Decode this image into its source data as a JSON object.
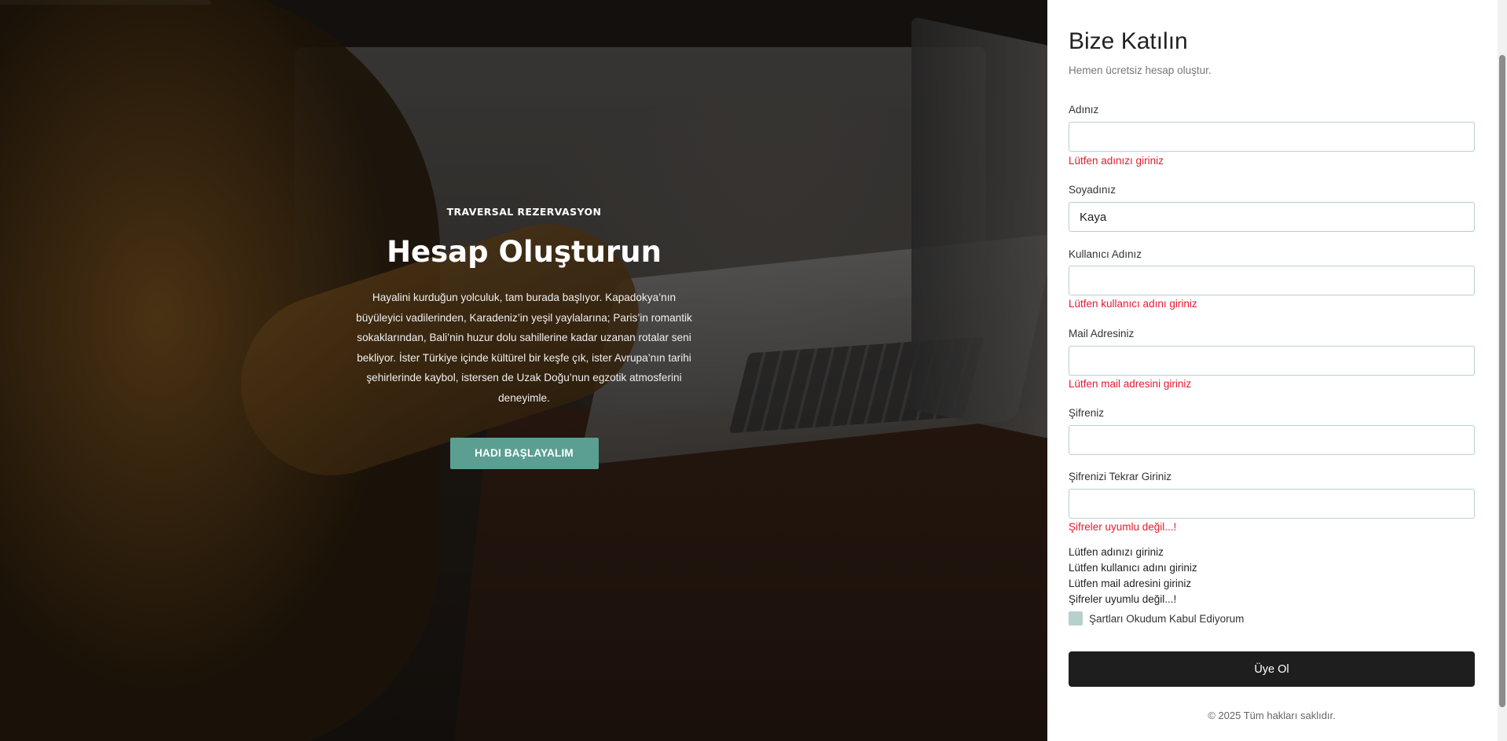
{
  "hero": {
    "eyebrow": "TRAVERSAL REZERVASYON",
    "title": "Hesap Oluşturun",
    "lines": [
      "Hayalini kurduğun yolculuk, tam burada başlıyor. Kapadokya’nın",
      "büyüleyici vadilerinden, Karadeniz’in yeşil yaylalarına; Paris’in romantik",
      "sokaklarından, Bali’nin huzur dolu sahillerine kadar uzanan rotalar seni",
      "bekliyor. İster Türkiye içinde kültürel bir keşfe çık, ister Avrupa’nın tarihi",
      "şehirlerinde kaybol, istersen de Uzak Doğu’nun egzotik atmosferini",
      "deneyimle."
    ],
    "button": "HADI BAŞLAYALIM",
    "accent_color": "#5a9f92"
  },
  "form": {
    "title": "Bize Katılın",
    "subtitle": "Hemen ücretsiz hesap oluştur.",
    "fields": {
      "first_name": {
        "label": "Adınız",
        "value": "",
        "error": "Lütfen adınızı giriniz"
      },
      "last_name": {
        "label": "Soyadınız",
        "value": "Kaya"
      },
      "username": {
        "label": "Kullanıcı Adınız",
        "value": "",
        "error": "Lütfen kullanıcı adını giriniz"
      },
      "email": {
        "label": "Mail Adresiniz",
        "value": "",
        "error": "Lütfen mail adresini giriniz"
      },
      "password": {
        "label": "Şifreniz",
        "value": ""
      },
      "password_confirm": {
        "label": "Şifrenizi Tekrar Giriniz",
        "value": "",
        "error": "Şifreler uyumlu değil...!"
      }
    },
    "summary_errors": [
      "Lütfen adınızı giriniz",
      "Lütfen kullanıcı adını giriniz",
      "Lütfen mail adresini giriniz",
      "Şifreler uyumlu değil...!"
    ],
    "terms_label": "Şartları Okudum Kabul Ediyorum",
    "terms_checked": false,
    "submit": "Üye Ol",
    "footer": "© 2025 Tüm hakları saklıdır.",
    "error_color": "#e21b2f"
  }
}
